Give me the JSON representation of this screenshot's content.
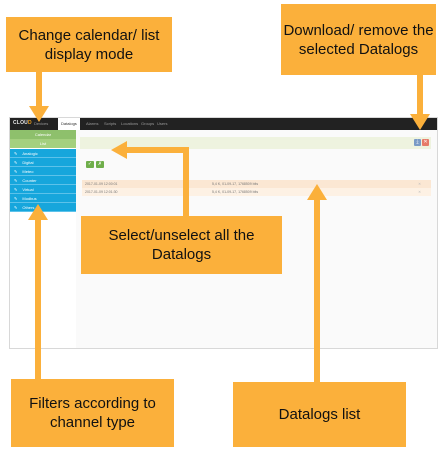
{
  "callouts": {
    "mode": "Change calendar/ list display mode",
    "download": "Download/ remove the selected Datalogs",
    "select": "Select/unselect all the Datalogs",
    "filters": "Filters according to channel type",
    "list": "Datalogs list"
  },
  "app": {
    "logo_main": "CLOU",
    "logo_accent": "D",
    "tabs": [
      "Devices",
      "Datalogs",
      "Alarms",
      "Scripts",
      "Locations",
      "Groups",
      "Users"
    ],
    "sidebar": {
      "mode_buttons": [
        "Calendar",
        "List"
      ],
      "channels": [
        "Analogic",
        "Digital",
        "Meteo",
        "Counter",
        "Virtual",
        "Modbus",
        "Others"
      ]
    },
    "actions": {
      "download_icon": "⤓",
      "remove_icon": "✕"
    },
    "select_icons": [
      "✓",
      "✗"
    ],
    "datalogs": [
      {
        "timestamp": "2017-01-09 12:00:01",
        "info": "5,4 K, 01-09-17, 1768509 bits",
        "action_icon": "✕"
      },
      {
        "timestamp": "2017-01-09 12:01:30",
        "info": "5,4 K, 01-09-17, 1768509 bits",
        "action_icon": "✕"
      }
    ]
  },
  "colors": {
    "callout": "#fbb03b",
    "sidebar_blue": "#16a6dc",
    "sidebar_green": "#8ec06c",
    "topbar": "#222222"
  }
}
